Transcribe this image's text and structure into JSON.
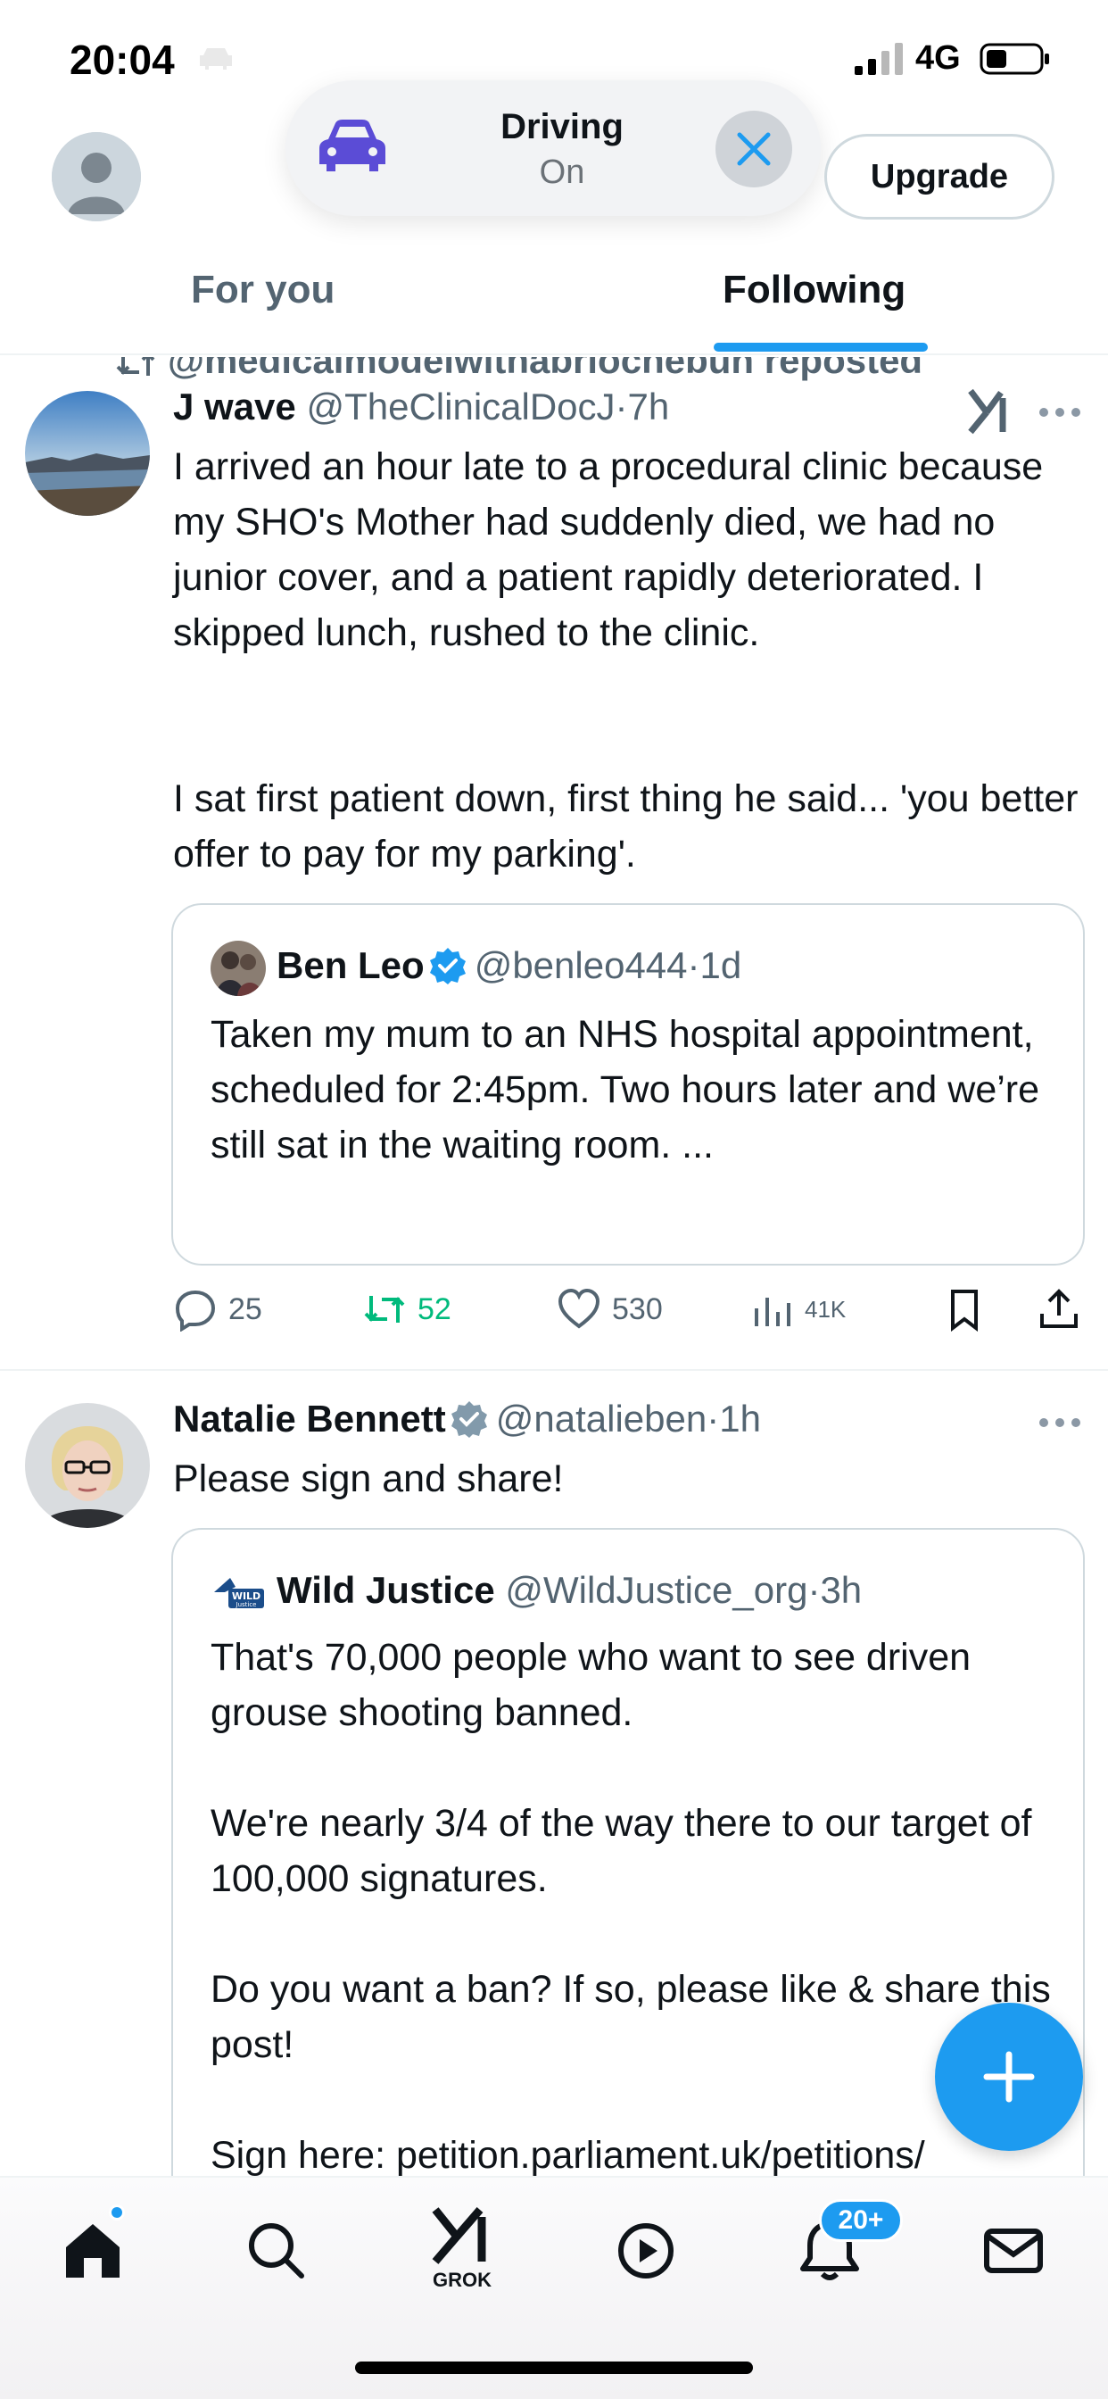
{
  "status_bar": {
    "time": "20:04",
    "network": "4G"
  },
  "header": {
    "driving": {
      "title": "Driving",
      "status": "On"
    },
    "upgrade_label": "Upgrade",
    "tabs": [
      {
        "label": "For you",
        "active": false
      },
      {
        "label": "Following",
        "active": true
      }
    ]
  },
  "feed": {
    "tweets": [
      {
        "repost_by": "@medicalmodelwithabriochebun reposted",
        "name": "J wave",
        "handle": "@TheClinicalDocJ",
        "time": "7h",
        "text_p1": "I arrived an hour late to a procedural clinic because my SHO's Mother had suddenly died, we had no junior cover, and a patient rapidly deteriorated. I skipped lunch, rushed to the clinic.",
        "text_p2": "I sat first patient down, first thing he said... 'you better offer to pay for my parking'.",
        "quote": {
          "name": "Ben Leo",
          "handle": "@benleo444",
          "time": "1d",
          "verified": true,
          "text": "Taken my mum to an NHS hospital appointment, scheduled for 2:45pm. Two hours later and we’re still sat in the waiting room. ..."
        },
        "stats": {
          "replies": "25",
          "reposts": "52",
          "likes": "530",
          "views": "41K"
        }
      },
      {
        "name": "Natalie Bennett",
        "handle": "@natalieben",
        "time": "1h",
        "verified": true,
        "text": "Please sign and share!",
        "quote": {
          "name": "Wild Justice",
          "handle": "@WildJustice_org",
          "time": "3h",
          "avatar_text": "WILD Justice",
          "text_p1": "That's 70,000 people who want to see driven grouse shooting banned.",
          "text_p2": "We're nearly 3/4 of the way there to our target of 100,000 signatures.",
          "text_p3": "Do you want a ban? If so, please like & share this post!",
          "text_p4": "Sign here: petition.parliament.uk/petitions/"
        }
      }
    ]
  },
  "bottom_nav": {
    "items": [
      "home",
      "search",
      "grok",
      "media",
      "notifications",
      "messages"
    ],
    "grok_label": "GROK",
    "notifications_badge": "20+"
  },
  "colors": {
    "accent": "#1d9bf0",
    "repost_green": "#00ba7c",
    "driving_purple": "#5b4cd6",
    "text": "#0f1419",
    "muted": "#536471"
  }
}
